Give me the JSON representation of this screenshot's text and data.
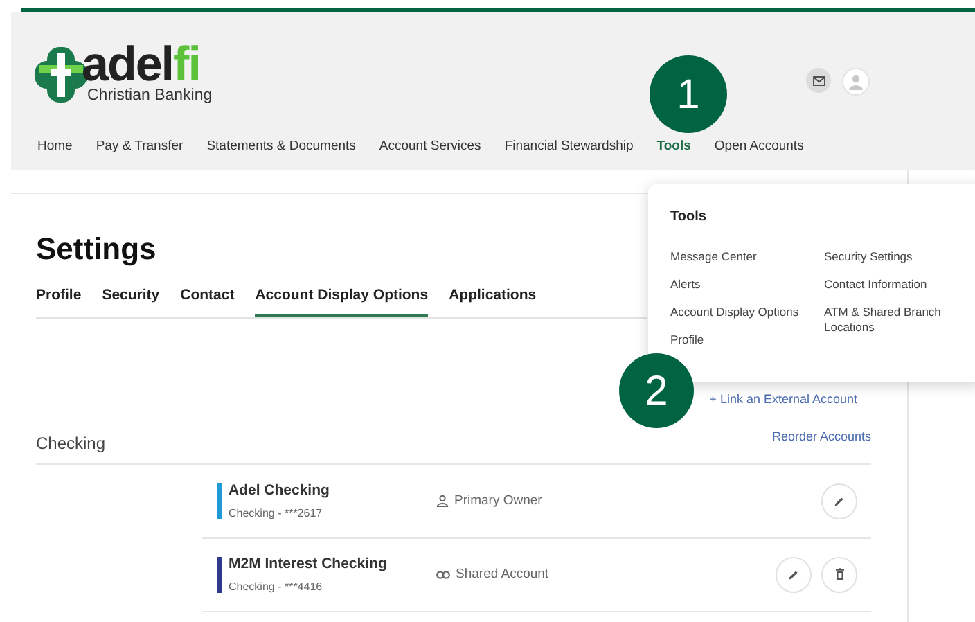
{
  "brand": {
    "name_dark": "adel",
    "name_green": "fi",
    "tagline": "Christian Banking"
  },
  "nav": [
    {
      "label": "Home",
      "selected": false
    },
    {
      "label": "Pay & Transfer",
      "selected": false
    },
    {
      "label": "Statements & Documents",
      "selected": false
    },
    {
      "label": "Account Services",
      "selected": false
    },
    {
      "label": "Financial Stewardship",
      "selected": false
    },
    {
      "label": "Tools",
      "selected": true
    },
    {
      "label": "Open Accounts",
      "selected": false
    }
  ],
  "page": {
    "title": "Settings"
  },
  "tabs": [
    {
      "label": "Profile",
      "selected": false
    },
    {
      "label": "Security",
      "selected": false
    },
    {
      "label": "Contact",
      "selected": false
    },
    {
      "label": "Account Display Options",
      "selected": true
    },
    {
      "label": "Applications",
      "selected": false
    }
  ],
  "link_external": {
    "icon": "+",
    "label": "Link an External Account"
  },
  "section": {
    "title": "Checking",
    "action": "Reorder Accounts"
  },
  "accounts": [
    {
      "name": "Adel Checking",
      "detail": "Checking - ***2617",
      "color": "#1f9ad6",
      "kind": "owner",
      "role": "Primary Owner",
      "deletable": false
    },
    {
      "name": "M2M Interest Checking",
      "detail": "Checking - ***4416",
      "color": "#2e3a8c",
      "kind": "shared",
      "role": "Shared Account",
      "deletable": true
    }
  ],
  "tools_menu": {
    "title": "Tools",
    "columns": [
      [
        "Message Center",
        "Alerts",
        "Account Display Options",
        "Profile"
      ],
      [
        "Security Settings",
        "Contact Information",
        "ATM & Shared Branch Locations"
      ]
    ]
  },
  "callouts": [
    {
      "number": "1",
      "kind": "nav"
    },
    {
      "number": "2",
      "kind": "link"
    }
  ]
}
